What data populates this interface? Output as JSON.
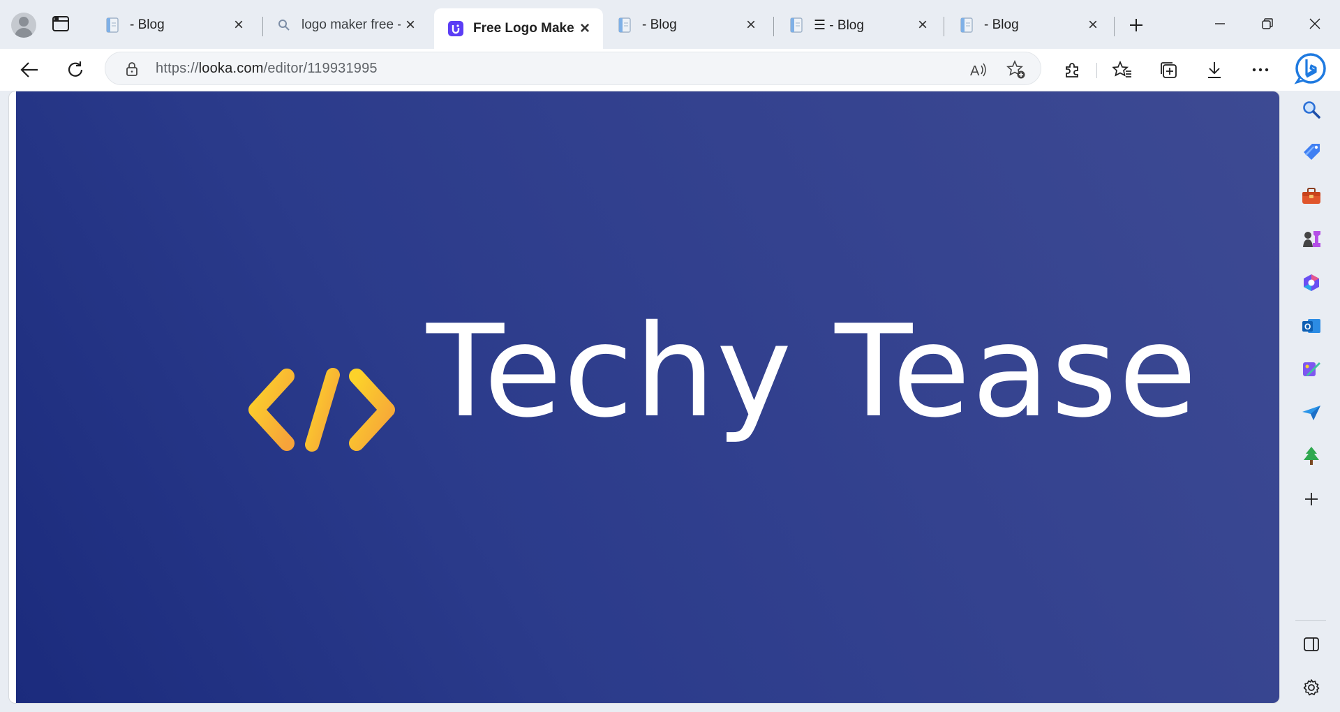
{
  "tabs": [
    {
      "title": "- Blog",
      "favicon": "document-icon",
      "active": false
    },
    {
      "title": "logo maker free - Search",
      "favicon": "search-icon",
      "active": false
    },
    {
      "title": "Free Logo Maker - Looka",
      "favicon": "looka-icon",
      "active": true
    },
    {
      "title": "- Blog",
      "favicon": "document-icon",
      "active": false
    },
    {
      "title": "☰ - Blog",
      "favicon": "document-icon",
      "active": false
    },
    {
      "title": "- Blog",
      "favicon": "document-icon",
      "active": false
    }
  ],
  "address_bar": {
    "scheme": "https://",
    "host": "looka.com",
    "path": "/editor/119931995"
  },
  "canvas": {
    "brand_name": "Techy Tease",
    "background_colors": [
      "#1b2b7d",
      "#3d4a93"
    ],
    "icon_colors": [
      "#fcd22a",
      "#f6a33a"
    ]
  },
  "toolbar_icons": [
    "read-aloud-icon",
    "add-favorite-icon",
    "extensions-icon",
    "favorites-icon",
    "collections-icon",
    "downloads-icon",
    "more-icon"
  ],
  "sidebar_icons": [
    "search-icon",
    "shopping-icon",
    "tools-icon",
    "games-icon",
    "office-icon",
    "outlook-icon",
    "designer-icon",
    "send-icon",
    "tree-icon",
    "add-icon",
    "split-screen-icon",
    "settings-icon"
  ]
}
